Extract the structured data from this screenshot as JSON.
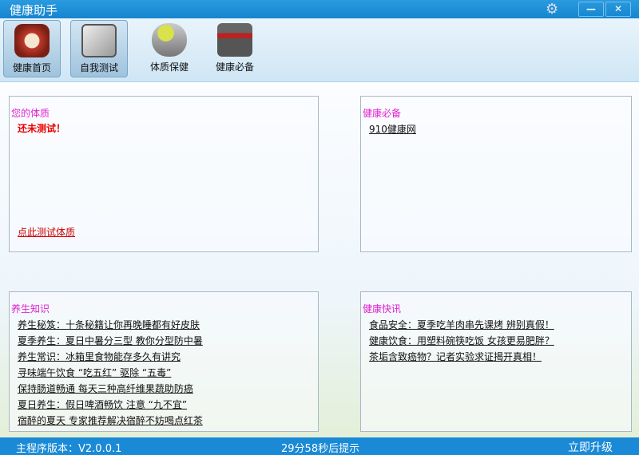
{
  "window": {
    "title": "健康助手"
  },
  "toolbar": [
    {
      "label": "健康首页"
    },
    {
      "label": "自我测试"
    },
    {
      "label": "体质保健"
    },
    {
      "label": "健康必备"
    }
  ],
  "constitution": {
    "title": "您的体质",
    "status": "还未测试！",
    "test_link": "点此测试体质"
  },
  "essentials": {
    "title": "健康必备",
    "links": [
      "910健康网"
    ]
  },
  "knowledge": {
    "title": "养生知识",
    "links": [
      "养生秘笈：十条秘籍让你再晚睡都有好皮肤",
      "夏季养生：夏日中暑分三型 教你分型防中暑",
      "养生常识：冰箱里食物能存多久有讲究",
      "寻味端午饮食 “吃五红” 驱除 “五毒”",
      "保持肠道畅通 每天三种高纤维果蔬助防癌",
      "夏日养生：假日啤酒畅饮 注意 “九不宜”",
      "宿醉的夏天 专家推荐解决宿醉不妨喝点红茶"
    ]
  },
  "news": {
    "title": "健康快讯",
    "links": [
      "食品安全：夏季吃羊肉串先课烤 辨别真假！",
      "健康饮食：用塑料碗筷吃饭 女孩更易肥胖？",
      "茶垢含致癌物？记者实验求证揭开真相！"
    ]
  },
  "status": {
    "version": "主程序版本：V2.0.0.1",
    "timer": "29分58秒后提示",
    "upgrade": "立即升级"
  },
  "window_buttons": {
    "minimize": "—",
    "close": "✕"
  }
}
